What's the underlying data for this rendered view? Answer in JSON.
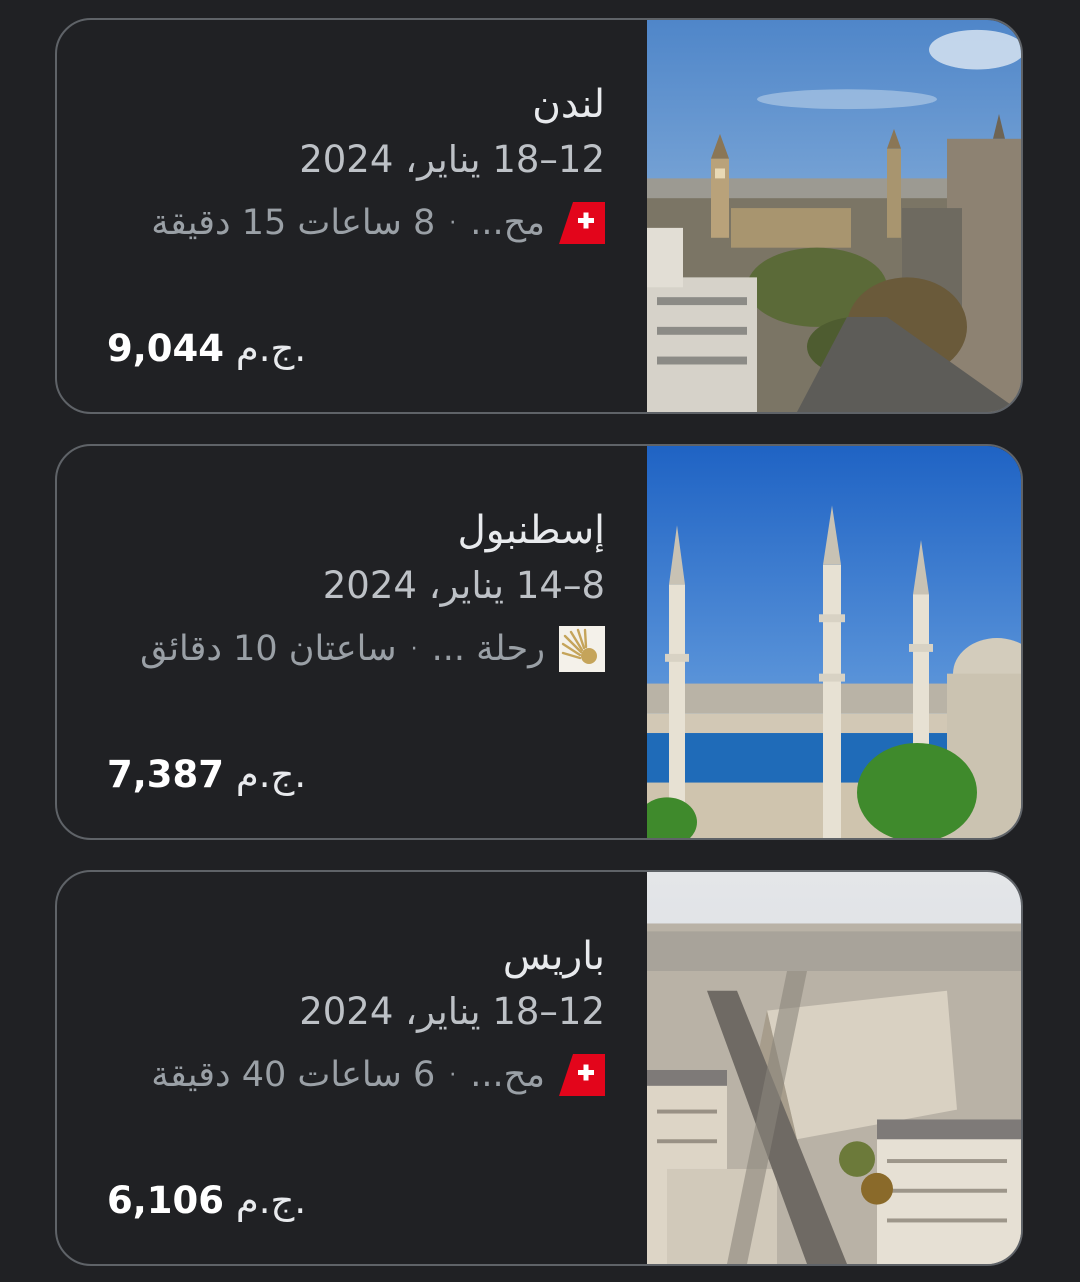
{
  "destinations": [
    {
      "city": "لندن",
      "dates": "12–18 يناير، 2024",
      "airline_short": "مح...",
      "duration": "8 ساعات 15 دقيقة",
      "airline_logo": "swiss-airline-icon",
      "price_value": "9,044",
      "currency": "ج.م.",
      "image": "london-photo"
    },
    {
      "city": "إسطنبول",
      "dates": "8–14 يناير، 2024",
      "airline_short": "رحلة ...",
      "duration": "ساعتان 10 دقائق",
      "airline_logo": "egyptair-airline-icon",
      "price_value": "7,387",
      "currency": "ج.م.",
      "image": "istanbul-photo"
    },
    {
      "city": "باريس",
      "dates": "12–18 يناير، 2024",
      "airline_short": "مح...",
      "duration": "6 ساعات 40 دقيقة",
      "airline_logo": "swiss-airline-icon",
      "price_value": "6,106",
      "currency": "ج.م.",
      "image": "paris-photo"
    }
  ],
  "separator": "·",
  "colors": {
    "background": "#202124",
    "card_border": "#5f6368",
    "primary_text": "#e8eaed",
    "secondary_text": "#bdc1c6",
    "tertiary_text": "#9aa0a6",
    "swiss_red": "#e3051b",
    "egyptair_gold": "#c5a45a"
  }
}
